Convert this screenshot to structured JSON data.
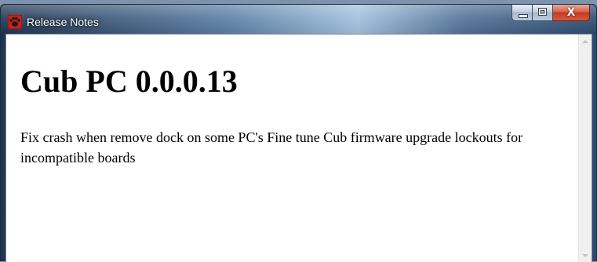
{
  "window": {
    "title": "Release Notes",
    "icon": "paw-icon",
    "controls": {
      "minimize": "minimize-icon",
      "maximize": "maximize-icon",
      "close_label": "X"
    }
  },
  "notes": {
    "heading": "Cub PC 0.0.0.13",
    "body": "Fix crash when remove dock on some PC's Fine tune Cub firmware upgrade lockouts for incompatible boards"
  },
  "colors": {
    "app_icon_bg": "#cc1f1a",
    "close_button": "#c3391f",
    "content_bg": "#ffffff"
  }
}
